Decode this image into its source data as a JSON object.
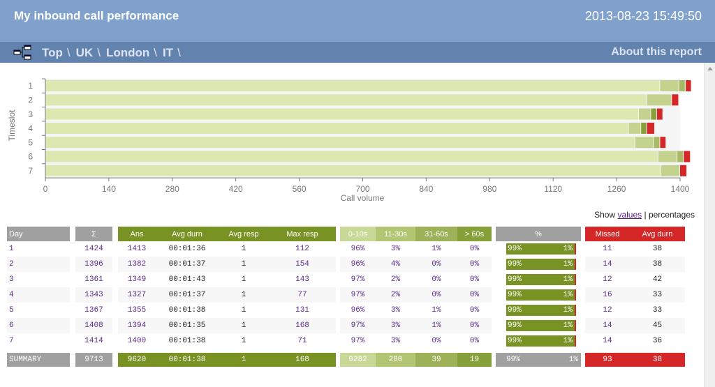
{
  "header": {
    "title": "My inbound call performance",
    "datetime": "2013-08-23 15:49:50"
  },
  "nav": {
    "breadcrumbs": [
      "Top",
      "UK",
      "London",
      "IT"
    ],
    "separator": "\\",
    "about_label": "About this report"
  },
  "icons": {
    "nav": "hierarchy-icon",
    "scroll": "scroll-up-arrow-icon"
  },
  "colors": {
    "header_bg": "#7fa1cb",
    "nav_bg": "#6283ad",
    "answered": "#789224",
    "band_0_10": "#dde8b0",
    "band_11_30": "#c3d38d",
    "band_31_60": "#a6bb64",
    "band_gt60": "#86a03a",
    "missed": "#d62728",
    "grey": "#a0a0a0"
  },
  "chart_data": {
    "type": "bar",
    "orientation": "horizontal",
    "stacked": true,
    "title": "",
    "xlabel": "Call volume",
    "ylabel": "Timeslot",
    "categories": [
      "1",
      "2",
      "3",
      "4",
      "5",
      "6",
      "7"
    ],
    "xlim": [
      0,
      1400
    ],
    "xticks": [
      0,
      140,
      280,
      420,
      560,
      700,
      840,
      980,
      1120,
      1260,
      1400
    ],
    "grid": false,
    "legend": "none",
    "series": [
      {
        "name": "0-10s",
        "values": [
          1356,
          1327,
          1309,
          1287,
          1301,
          1352,
          1358
        ]
      },
      {
        "name": "11-30s",
        "values": [
          42,
          55,
          27,
          27,
          41,
          42,
          42
        ]
      },
      {
        "name": "31-60s",
        "values": [
          14,
          0,
          0,
          0,
          14,
          14,
          0
        ]
      },
      {
        "name": "> 60s",
        "values": [
          1,
          0,
          13,
          13,
          0,
          0,
          0
        ]
      },
      {
        "name": "Missed",
        "values": [
          11,
          14,
          12,
          16,
          12,
          14,
          14
        ]
      }
    ]
  },
  "toggle": {
    "show": "Show",
    "values": "values",
    "sep": "|",
    "percentages": "percentages"
  },
  "table": {
    "headers": {
      "day": "Day",
      "total": "Σ",
      "ans": "Ans",
      "avg_durn": "Avg durn",
      "avg_resp": "Avg resp",
      "max_resp": "Max resp",
      "b1": "0-10s",
      "b2": "11-30s",
      "b3": "31-60s",
      "b4": "> 60s",
      "pct": "%",
      "missed": "Missed",
      "missed_avg_durn": "Avg durn"
    },
    "rows": [
      {
        "day": "1",
        "total": "1424",
        "ans": "1413",
        "avg_durn": "00:01:36",
        "avg_resp": "1",
        "max_resp": "112",
        "b1": "96%",
        "b2": "3%",
        "b3": "1%",
        "b4": "0%",
        "pct_ans": "99%",
        "pct_missed": "1%",
        "missed": "11",
        "missed_avg": "38"
      },
      {
        "day": "2",
        "total": "1396",
        "ans": "1382",
        "avg_durn": "00:01:37",
        "avg_resp": "1",
        "max_resp": "154",
        "b1": "96%",
        "b2": "4%",
        "b3": "0%",
        "b4": "0%",
        "pct_ans": "99%",
        "pct_missed": "1%",
        "missed": "14",
        "missed_avg": "38"
      },
      {
        "day": "3",
        "total": "1361",
        "ans": "1349",
        "avg_durn": "00:01:43",
        "avg_resp": "1",
        "max_resp": "143",
        "b1": "97%",
        "b2": "2%",
        "b3": "0%",
        "b4": "0%",
        "pct_ans": "99%",
        "pct_missed": "1%",
        "missed": "12",
        "missed_avg": "42"
      },
      {
        "day": "4",
        "total": "1343",
        "ans": "1327",
        "avg_durn": "00:01:37",
        "avg_resp": "1",
        "max_resp": "77",
        "b1": "97%",
        "b2": "2%",
        "b3": "0%",
        "b4": "0%",
        "pct_ans": "99%",
        "pct_missed": "1%",
        "missed": "16",
        "missed_avg": "33"
      },
      {
        "day": "5",
        "total": "1367",
        "ans": "1355",
        "avg_durn": "00:01:38",
        "avg_resp": "1",
        "max_resp": "131",
        "b1": "96%",
        "b2": "3%",
        "b3": "1%",
        "b4": "0%",
        "pct_ans": "99%",
        "pct_missed": "1%",
        "missed": "12",
        "missed_avg": "33"
      },
      {
        "day": "6",
        "total": "1408",
        "ans": "1394",
        "avg_durn": "00:01:35",
        "avg_resp": "1",
        "max_resp": "168",
        "b1": "97%",
        "b2": "3%",
        "b3": "1%",
        "b4": "0%",
        "pct_ans": "99%",
        "pct_missed": "1%",
        "missed": "14",
        "missed_avg": "45"
      },
      {
        "day": "7",
        "total": "1414",
        "ans": "1400",
        "avg_durn": "00:01:38",
        "avg_resp": "1",
        "max_resp": "71",
        "b1": "97%",
        "b2": "3%",
        "b3": "0%",
        "b4": "0%",
        "pct_ans": "99%",
        "pct_missed": "1%",
        "missed": "14",
        "missed_avg": "36"
      }
    ],
    "summary": {
      "day": "SUMMARY",
      "total": "9713",
      "ans": "9620",
      "avg_durn": "00:01:38",
      "avg_resp": "1",
      "max_resp": "168",
      "b1": "9282",
      "b2": "280",
      "b3": "39",
      "b4": "19",
      "pct_ans": "99%",
      "pct_missed": "1%",
      "missed": "93",
      "missed_avg": "38"
    }
  }
}
